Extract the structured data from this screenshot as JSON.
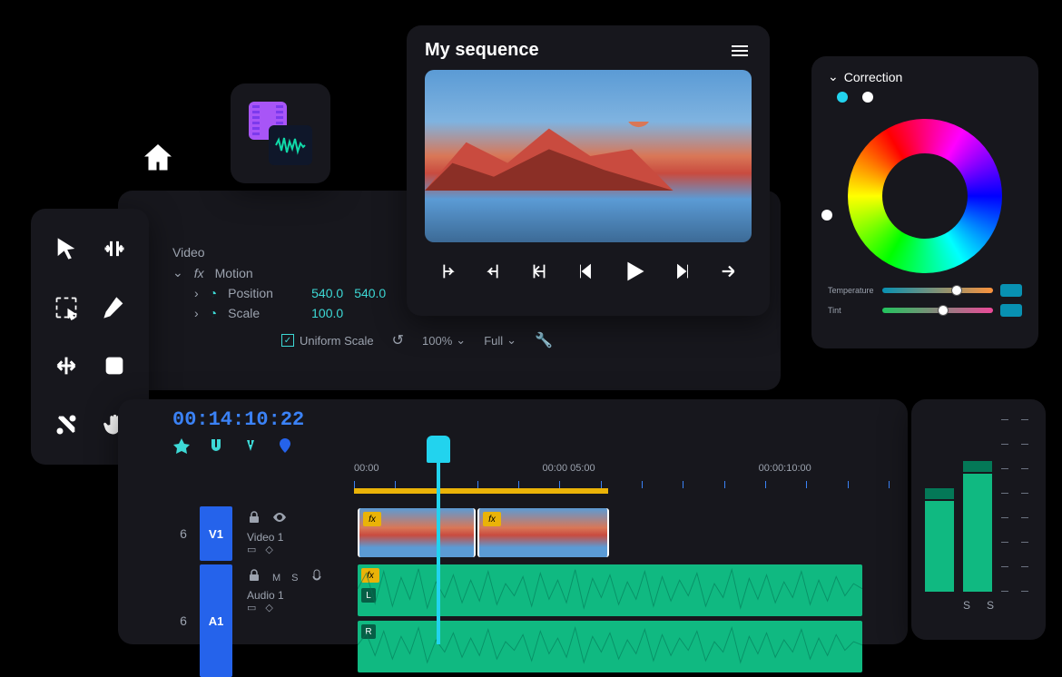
{
  "home": {
    "name": "home"
  },
  "media_icons": {
    "filmstrip": "filmstrip",
    "waveform": "waveform"
  },
  "tools": [
    {
      "name": "selection-tool"
    },
    {
      "name": "ripple-edit-tool"
    },
    {
      "name": "marquee-select-tool"
    },
    {
      "name": "pen-tool"
    },
    {
      "name": "slip-tool"
    },
    {
      "name": "rectangle-tool"
    },
    {
      "name": "razor-tool"
    },
    {
      "name": "hand-tool"
    }
  ],
  "effects": {
    "section": "Video",
    "group": "Motion",
    "rows": [
      {
        "label": "Position",
        "x": "540.0",
        "y": "540.0"
      },
      {
        "label": "Scale",
        "val": "100.0"
      }
    ],
    "uniform_scale_label": "Uniform Scale",
    "zoom": "100%",
    "fit": "Full"
  },
  "preview": {
    "title": "My sequence",
    "controls": [
      {
        "name": "mark-in"
      },
      {
        "name": "mark-out"
      },
      {
        "name": "go-to-in"
      },
      {
        "name": "step-back"
      },
      {
        "name": "play"
      },
      {
        "name": "step-forward"
      },
      {
        "name": "go-to-out"
      }
    ]
  },
  "correction": {
    "title": "Correction",
    "dots": [
      {
        "color": "#22d3ee"
      },
      {
        "color": "#ffffff"
      }
    ],
    "sliders": [
      {
        "label": "Temperature",
        "type": "temp",
        "pos": 62
      },
      {
        "label": "Tint",
        "type": "tint",
        "pos": 50
      }
    ]
  },
  "timeline": {
    "timecode": "00:14:10:22",
    "tc_tools": [
      "snap",
      "magnet",
      "link",
      "marker"
    ],
    "ruler": [
      "00:00",
      "00:00 05:00",
      "00:00:10:00"
    ],
    "tracks": {
      "video": {
        "idx": "6",
        "badge": "V1",
        "name": "Video 1"
      },
      "audio": {
        "idx": "6",
        "badge": "A1",
        "name": "Audio 1",
        "m": "M",
        "s": "S"
      }
    },
    "clips": {
      "video_fx": "fx",
      "audio_l": "L",
      "audio_r": "R"
    }
  },
  "meters": {
    "bars": [
      {
        "height": 100
      },
      {
        "height": 130
      }
    ],
    "labels": [
      "S",
      "S"
    ]
  }
}
